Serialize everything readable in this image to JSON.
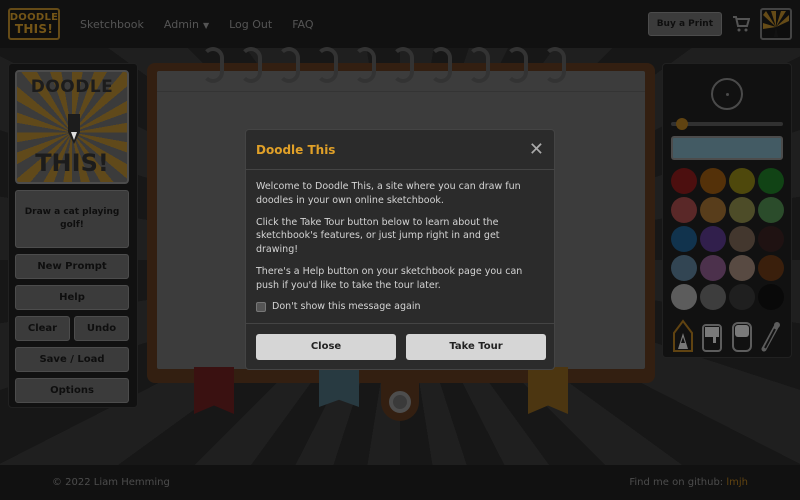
{
  "navbar": {
    "brand_line1": "DOODLE",
    "brand_line2": "THIS!",
    "links": [
      "Sketchbook",
      "Admin",
      "Log Out",
      "FAQ"
    ],
    "buy_label": "Buy a Print"
  },
  "left_panel": {
    "logo_line1": "DOODLE",
    "logo_line2": "THIS!",
    "prompt": "Draw a cat playing golf!",
    "new_prompt": "New Prompt",
    "help": "Help",
    "clear": "Clear",
    "undo": "Undo",
    "save_load": "Save / Load",
    "options": "Options"
  },
  "right_panel": {
    "brush_size_fraction": 0.05,
    "current_color": "#7aa6b6",
    "swatches": [
      "#8a1d1d",
      "#9a5a12",
      "#8f8416",
      "#1f7a27",
      "#a54949",
      "#a07032",
      "#8c8b4a",
      "#4f8a4f",
      "#1f5d8c",
      "#5a3a8a",
      "#7a6454",
      "#3a2222",
      "#5b7f98",
      "#8a5a8a",
      "#a08878",
      "#6b3a16",
      "#a8a8a8",
      "#707070",
      "#3a3a3a",
      "#111111"
    ],
    "tools": [
      "pencil-icon",
      "paint-bucket-icon",
      "eraser-icon",
      "eyedropper-icon"
    ]
  },
  "modal": {
    "title": "Doodle This",
    "p1": "Welcome to Doodle This, a site where you can draw fun doodles in your own online sketchbook.",
    "p2": "Click the Take Tour button below to learn about the sketchbook's features, or just jump right in and get drawing!",
    "p3": "There's a Help button on your sketchbook page you can push if you'd like to take the tour later.",
    "checkbox_label": "Don't show this message again",
    "close_label": "Close",
    "tour_label": "Take Tour"
  },
  "footer": {
    "copyright": "© 2022 Liam Hemming",
    "github_prefix": "Find me on github:",
    "github_user": "lmjh"
  }
}
